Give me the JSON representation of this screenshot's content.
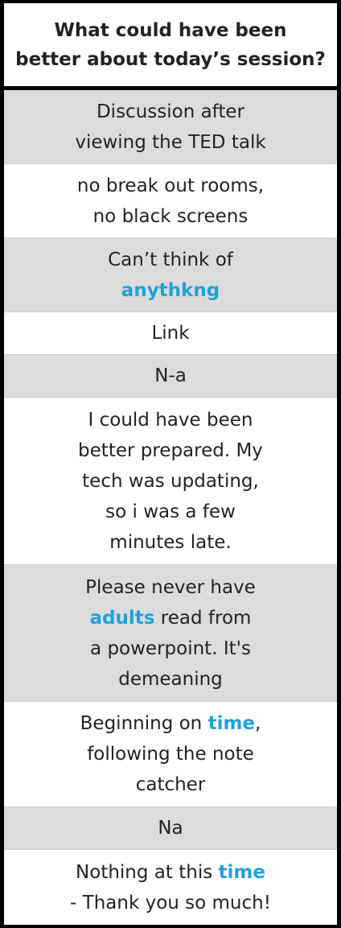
{
  "header": {
    "title_line1": "What could have been",
    "title_line2": "better about today’s session?"
  },
  "responses": [
    {
      "lines": [
        [
          "Discussion after"
        ],
        [
          "viewing the TED talk"
        ]
      ]
    },
    {
      "lines": [
        [
          "no break out rooms,"
        ],
        [
          "no black screens"
        ]
      ]
    },
    {
      "lines": [
        [
          "Can’t think of"
        ],
        [
          "anythkng"
        ]
      ]
    },
    {
      "lines": [
        [
          "Link"
        ]
      ]
    },
    {
      "lines": [
        [
          "N-a"
        ]
      ]
    },
    {
      "lines": [
        [
          "I could have been"
        ],
        [
          "better prepared. My"
        ],
        [
          "tech was updating,"
        ],
        [
          "so i was a few"
        ],
        [
          "minutes late."
        ]
      ]
    },
    {
      "lines": [
        [
          "Please never have"
        ],
        [
          "adults",
          " read from"
        ],
        [
          "a powerpoint. It's"
        ],
        [
          "demeaning"
        ]
      ]
    },
    {
      "lines": [
        [
          "Beginning on ",
          "time",
          ","
        ],
        [
          "following the note"
        ],
        [
          "catcher"
        ]
      ]
    },
    {
      "lines": [
        [
          "Na"
        ]
      ]
    },
    {
      "lines": [
        [
          "Nothing at this ",
          "time"
        ],
        [
          "- Thank you so much!"
        ]
      ]
    }
  ],
  "highlight_color": "#1ea2dc"
}
